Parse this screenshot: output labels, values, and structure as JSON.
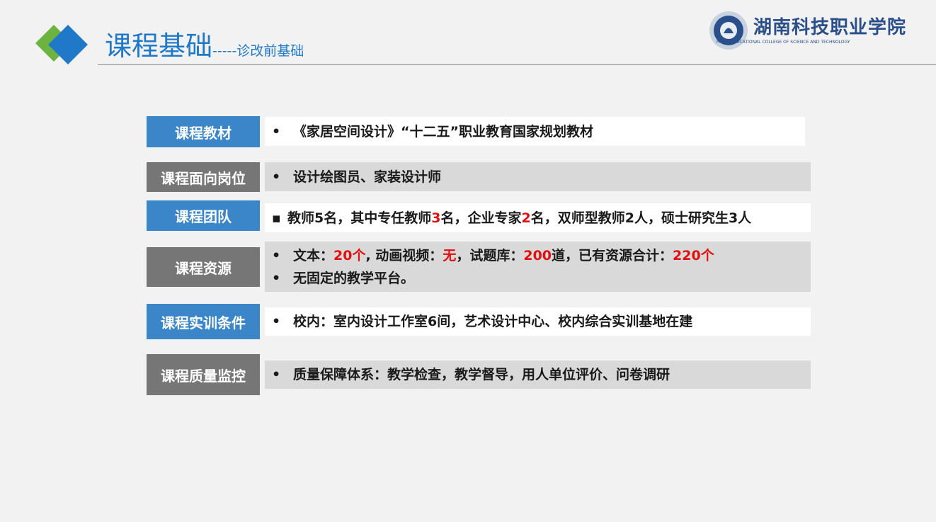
{
  "header": {
    "title": "课程基础",
    "subtitle": "-----诊改前基础",
    "school_name_cn": "湖南科技职业学院",
    "school_name_en": "HUNAN VOCATIONAL COLLEGE OF SCIENCE AND TECHNOLOGY"
  },
  "colors": {
    "accent_blue": "#3a86c8",
    "label_grey": "#767676",
    "highlight_red": "#e01010"
  },
  "rows": [
    {
      "label": "课程教材",
      "bullet": "•",
      "text": "《家居空间设计》“十二五”职业教育国家规划教材"
    },
    {
      "label": "课程面向岗位",
      "bullet": "•",
      "text": "设计绘图员、家装设计师"
    },
    {
      "label": "课程团队",
      "bullet": "▪",
      "t1": "教师5名，其中专任教师",
      "n1": "3",
      "t2": "名，企业专家",
      "n2": "2",
      "t3": "名，双师型教师2人，硕士研究生3人"
    },
    {
      "label": "课程资源",
      "bullet": "•",
      "a1": "文本：",
      "v1": "20个",
      "a2": ", 动画视频：",
      "v2": "无",
      "a3": "，试题库：",
      "v3": "200",
      "a4": "道，已有资源合计：",
      "v4": "220个",
      "bullet2": "•",
      "text2": "无固定的教学平台。"
    },
    {
      "label": "课程实训条件",
      "bullet": "•",
      "text": "校内：室内设计工作室6间，艺术设计中心、校内综合实训基地在建"
    },
    {
      "label": "课程质量监控",
      "bullet": "•",
      "text": "质量保障体系：教学检查，教学督导，用人单位评价、问卷调研"
    }
  ]
}
